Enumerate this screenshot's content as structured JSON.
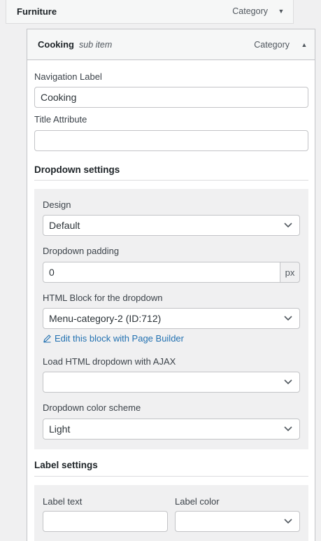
{
  "parent_item": {
    "title": "Furniture",
    "type": "Category",
    "caret": "▼"
  },
  "sub_item": {
    "title": "Cooking",
    "subtitle": "sub item",
    "type": "Category",
    "caret": "▲"
  },
  "fields": {
    "nav_label": {
      "label": "Navigation Label",
      "value": "Cooking"
    },
    "title_attr": {
      "label": "Title Attribute",
      "value": ""
    }
  },
  "dropdown_settings": {
    "heading": "Dropdown settings",
    "design": {
      "label": "Design",
      "value": "Default"
    },
    "padding": {
      "label": "Dropdown padding",
      "value": "0",
      "unit": "px"
    },
    "html_block": {
      "label": "HTML Block for the dropdown",
      "value": "Menu-category-2 (ID:712)"
    },
    "edit_link": "Edit this block with Page Builder",
    "ajax": {
      "label": "Load HTML dropdown with AJAX",
      "value": ""
    },
    "color_scheme": {
      "label": "Dropdown color scheme",
      "value": "Light"
    }
  },
  "label_settings": {
    "heading": "Label settings",
    "label_text": {
      "label": "Label text",
      "value": ""
    },
    "label_color": {
      "label": "Label color",
      "value": ""
    }
  },
  "colors": {
    "link": "#2271b1",
    "border": "#c3c4c7",
    "panel": "#f0f0f1"
  }
}
